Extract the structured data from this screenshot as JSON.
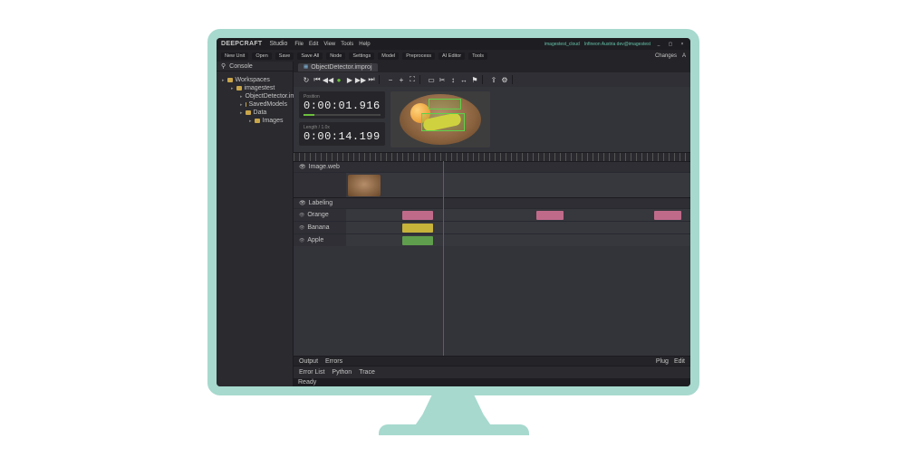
{
  "title": {
    "brand": "DEEPCRAFT",
    "product": "Studio"
  },
  "menu": [
    "File",
    "Edit",
    "View",
    "Tools",
    "Help"
  ],
  "titleRight": {
    "project": "imagestest_cloud",
    "user": "Infineon Austria    dev@imagestest"
  },
  "winbtns": {
    "min": "_",
    "max": "▢",
    "close": "×"
  },
  "toolbar": [
    "New Unit",
    "Open",
    "Save",
    "Save All",
    "Node",
    "Settings",
    "Model",
    "Preprocess",
    "AI Editor",
    "Tools"
  ],
  "toolbarRight": [
    "Changes",
    "A"
  ],
  "sidebar": {
    "head": "Console",
    "root": "Workspaces",
    "items": [
      "imagestest",
      "ObjectDetector.improj",
      "SavedModels",
      "Data",
      "Images"
    ]
  },
  "tab": "ObjectDetector.improj",
  "times": {
    "posLbl": "Position",
    "pos": "0:00:01.916",
    "lenLbl": "Length / 1.0x",
    "len": "0:00:14.199"
  },
  "sections": {
    "image": "Image.web",
    "label": "Labeling"
  },
  "labels": [
    "Orange",
    "Banana",
    "Apple"
  ],
  "bottomTabs": [
    "Output",
    "Errors"
  ],
  "bottomTabsRight": [
    "Plug",
    "Edit"
  ],
  "panel2": [
    "Error List",
    "Python",
    "Trace",
    "",
    ""
  ],
  "status": "Ready"
}
